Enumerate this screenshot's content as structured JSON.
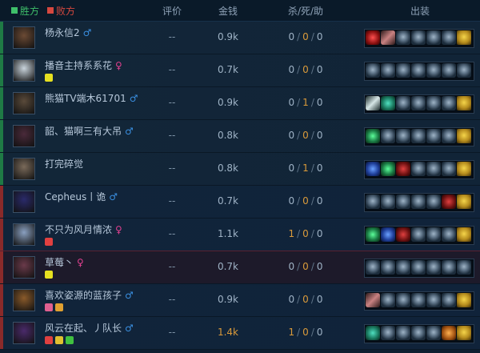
{
  "header": {
    "win_label": "胜方",
    "lose_label": "败方",
    "col_rate": "评价",
    "col_money": "金钱",
    "col_kda": "杀/死/助",
    "col_items": "出装",
    "win_color": "#3fbf6a",
    "lose_color": "#d6483f"
  },
  "players": [
    {
      "team": "win",
      "name": "杨永信2",
      "gender": "♂",
      "badges": [],
      "rate": "--",
      "money": "0.9k",
      "k": "0",
      "d": "0",
      "a": "0",
      "avatar": "#6b4a34",
      "items": [
        "red",
        "sword",
        "g",
        "g",
        "g",
        "g",
        "trinket"
      ]
    },
    {
      "team": "win",
      "name": "播音主持系系花",
      "gender": "♀",
      "badges": [
        "#e6e020"
      ],
      "rate": "--",
      "money": "0.7k",
      "k": "0",
      "d": "0",
      "a": "0",
      "avatar": "#c9d4dc",
      "items": [
        "g",
        "g",
        "g",
        "g",
        "g",
        "g",
        "g"
      ]
    },
    {
      "team": "win",
      "name": "熊猫TV端木61701",
      "gender": "♂",
      "badges": [],
      "rate": "--",
      "money": "0.9k",
      "k": "0",
      "d": "1",
      "a": "0",
      "avatar": "#5a4a3a",
      "items": [
        "blade",
        "teal",
        "g",
        "g",
        "g",
        "g",
        "trinket"
      ]
    },
    {
      "team": "win",
      "name": "韶、猫啊三有大吊",
      "gender": "♂",
      "badges": [],
      "rate": "--",
      "money": "0.8k",
      "k": "0",
      "d": "0",
      "a": "0",
      "avatar": "#4a2a3a",
      "items": [
        "green",
        "g",
        "g",
        "g",
        "g",
        "g",
        "trinket"
      ]
    },
    {
      "team": "win",
      "name": "打完碎觉",
      "gender": "",
      "badges": [],
      "rate": "--",
      "money": "0.8k",
      "k": "0",
      "d": "1",
      "a": "0",
      "avatar": "#7a6a5a",
      "items": [
        "blue",
        "green",
        "dred",
        "g",
        "g",
        "g",
        "trinket"
      ]
    },
    {
      "team": "lose",
      "name": "Cepheus丨诡",
      "gender": "♂",
      "badges": [],
      "rate": "--",
      "money": "0.7k",
      "k": "0",
      "d": "0",
      "a": "0",
      "avatar": "#2a2a6a",
      "items": [
        "g",
        "g",
        "g",
        "g",
        "g",
        "dred",
        "trinket"
      ]
    },
    {
      "team": "lose",
      "name": "不只为风月情浓",
      "gender": "♀",
      "badges": [
        "#e04040"
      ],
      "rate": "--",
      "money": "1.1k",
      "k": "1",
      "d": "0",
      "a": "0",
      "avatar": "#8aa0c0",
      "items": [
        "green",
        "blue",
        "dred",
        "g",
        "g",
        "g",
        "trinket"
      ]
    },
    {
      "team": "lose",
      "name": "草莓丶",
      "gender": "♀",
      "badges": [
        "#e6e020"
      ],
      "rate": "--",
      "money": "0.7k",
      "k": "0",
      "d": "0",
      "a": "0",
      "avatar": "#6a3a4a",
      "highlight": true,
      "items": [
        "g",
        "g",
        "g",
        "g",
        "g",
        "g",
        "g"
      ]
    },
    {
      "team": "lose",
      "name": "喜欢姿源的蓝孩子",
      "gender": "♂",
      "badges": [
        "#e06090",
        "#e0a030"
      ],
      "rate": "--",
      "money": "0.9k",
      "k": "0",
      "d": "0",
      "a": "0",
      "avatar": "#8a5a2a",
      "items": [
        "sword",
        "g",
        "g",
        "g",
        "g",
        "g",
        "trinket"
      ]
    },
    {
      "team": "lose",
      "name": "风云在起、丿队长",
      "gender": "♂",
      "badges": [
        "#e04040",
        "#e0c030",
        "#40c040"
      ],
      "rate": "--",
      "money": "1.4k",
      "k": "1",
      "d": "0",
      "a": "0",
      "avatar": "#4a2a6a",
      "gold_money": true,
      "items": [
        "teal",
        "g",
        "g",
        "g",
        "g",
        "orange",
        "trinket"
      ]
    }
  ]
}
